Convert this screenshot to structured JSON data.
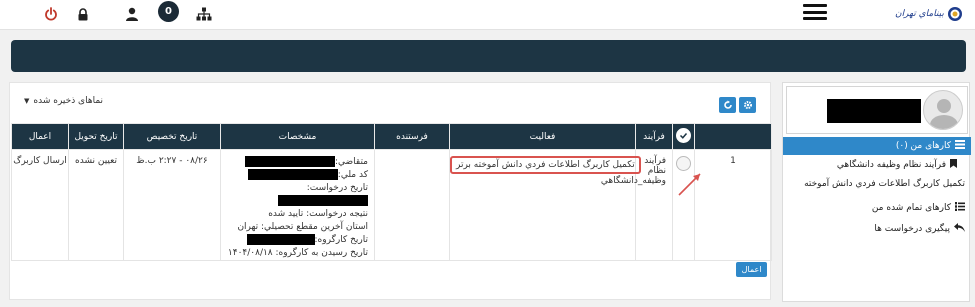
{
  "header": {
    "logo_text": "بيناماي تهران",
    "notification_count": "0"
  },
  "toolbar": {
    "views_label": "نماهای ذخيره شده"
  },
  "table": {
    "columns": [
      "",
      "",
      "فرآيند",
      "فعاليت",
      "فرستنده",
      "مشخصات",
      "تاريخ تخصيص",
      "تاريخ تحويل",
      "اعمال"
    ],
    "row": {
      "index": "1",
      "process": "فرآيند نظام وظيفه_دانشگاهي",
      "activity": "تكميل كاربرگ اطلاعات فردي دانش آموخته برتر",
      "sender": "",
      "details": {
        "applicant_label": "متقاضي:",
        "national_code_label": "كد ملي:",
        "request_date_label": "تاريخ درخواست:",
        "result": "نتيجه درخواست: تاييد شده",
        "province": "استان آخرين مقطع تحصيلي: تهران",
        "workgroup_date_label": "تاريخ كارگروه:",
        "arrival_date": "تاريخ رسيدن به كارگروه: ۱۴۰۴/۰۸/۱۸"
      },
      "assign_date": "۰۸/۲۶ - ۲:۲۷ ب.ظ",
      "delivery_date": "تعيين نشده",
      "action": "ارسال كاربرگ"
    }
  },
  "actions_button": "اعمال",
  "sidebar": {
    "items": [
      {
        "label": "كارهای من (۰)",
        "active": true
      },
      {
        "label": "فرآيند نظام وظيفه دانشگاهي"
      },
      {
        "label": "تكميل كاربرگ اطلاعات فردي دانش آموخته"
      },
      {
        "label": "كارهای تمام شده من"
      },
      {
        "label": "پيگيری درخواست ها"
      }
    ]
  },
  "colors": {
    "navy": "#1d3544",
    "accent_blue": "#2f88c9",
    "highlight_red": "#d9534f"
  }
}
